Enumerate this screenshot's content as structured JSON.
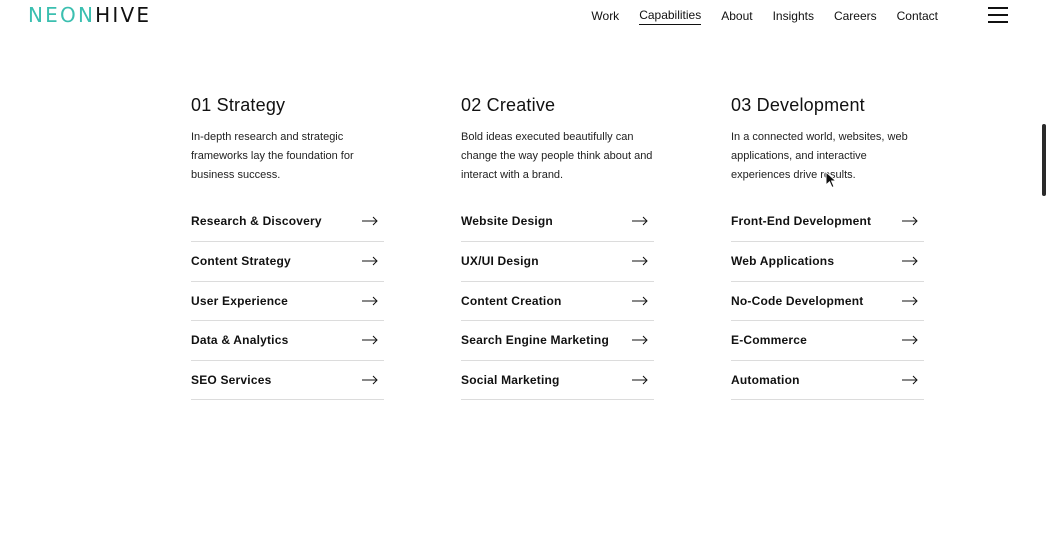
{
  "logo": {
    "neon": "NEON",
    "hive": "HIVE"
  },
  "colors": {
    "accent": "#3bbfb0",
    "text": "#111111",
    "divider": "#dcdcdc"
  },
  "nav": {
    "items": [
      {
        "label": "Work",
        "active": false
      },
      {
        "label": "Capabilities",
        "active": true
      },
      {
        "label": "About",
        "active": false
      },
      {
        "label": "Insights",
        "active": false
      },
      {
        "label": "Careers",
        "active": false
      },
      {
        "label": "Contact",
        "active": false
      }
    ],
    "menu_icon": "hamburger-icon"
  },
  "columns": [
    {
      "title": "01 Strategy",
      "description": "In-depth research and strategic frameworks lay the foundation for business success.",
      "links": [
        "Research & Discovery",
        "Content Strategy",
        "User Experience",
        "Data & Analytics",
        "SEO Services"
      ]
    },
    {
      "title": "02 Creative",
      "description": "Bold ideas executed beautifully can change the way people think about and interact with a brand.",
      "links": [
        "Website Design",
        "UX/UI Design",
        "Content Creation",
        "Search Engine Marketing",
        "Social Marketing"
      ]
    },
    {
      "title": "03 Development",
      "description": "In a connected world, websites, web applications, and interactive experiences drive results.",
      "links": [
        "Front-End Development",
        "Web Applications",
        "No-Code Development",
        "E-Commerce",
        "Automation"
      ]
    }
  ],
  "link_icon": "arrow-right-icon"
}
